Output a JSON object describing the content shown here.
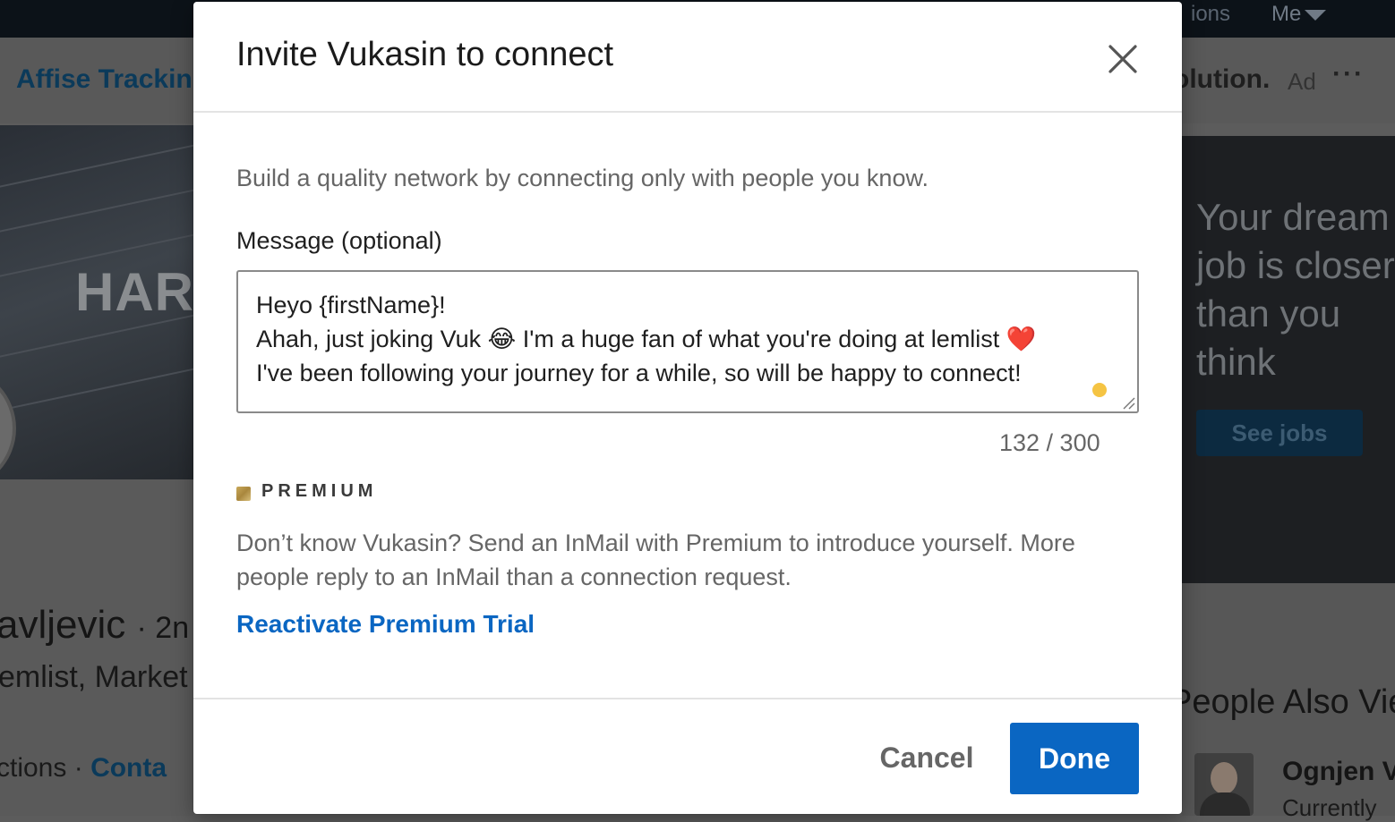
{
  "background": {
    "nav": {
      "item_partial": "ions",
      "me_label": "Me"
    },
    "ad_bar": {
      "left_text": "Affise Trackin",
      "right_text": "olution.",
      "ad_tag": "Ad",
      "more": "···"
    },
    "cover": {
      "text": "HAR"
    },
    "profile": {
      "name": "avljevic",
      "degree": "· 2n",
      "headline": "emlist, Market",
      "connections": "ctions",
      "dot": "·",
      "contact": "Conta"
    },
    "right_ad": {
      "line1": "Your dream",
      "line2": "job is closer",
      "line3": "than you",
      "line4": "think",
      "button": "See jobs"
    },
    "people": {
      "title": "People Also Vie",
      "person_name": "Ognjen V",
      "person_sub": "Currently"
    }
  },
  "modal": {
    "title": "Invite Vukasin to connect",
    "close_label": "Dismiss",
    "description": "Build a quality network by connecting only with people you know.",
    "message_label": "Message (optional)",
    "message_lines": [
      "Heyo {firstName}!",
      "Ahah, just joking Vuk 😂 I'm a huge fan of what you're doing at lemlist ❤️",
      "I've been following your journey for a while, so will be happy to connect!"
    ],
    "counter": "132 / 300",
    "premium_label": "PREMIUM",
    "premium_description": "Don’t know Vukasin? Send an InMail with Premium to introduce yourself. More people reply to an InMail than a connection request.",
    "reactivate_link": "Reactivate Premium Trial",
    "cancel_label": "Cancel",
    "done_label": "Done"
  },
  "colors": {
    "primary": "#0a66c2",
    "overlay_bg": "#5c5c5c",
    "muted_text": "#666666",
    "grammar_dot": "#f5c443",
    "premium_gold": "#c9a85a"
  },
  "icons": {
    "close": "close-icon",
    "premium": "premium-icon",
    "caret": "caret-down-icon",
    "resize": "resize-handle-icon",
    "grammar": "grammar-check-icon"
  }
}
